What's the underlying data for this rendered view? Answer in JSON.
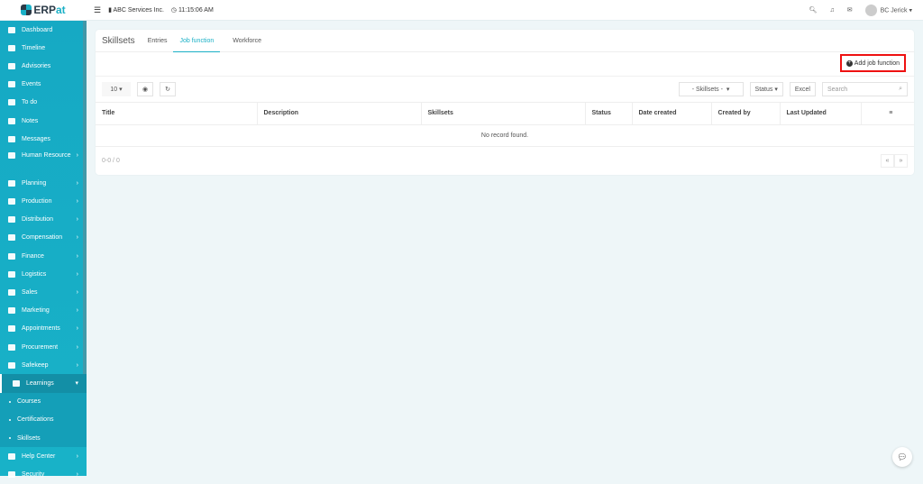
{
  "header": {
    "brand": "ERPat",
    "company": "ABC Services Inc.",
    "time": "11:15:06 AM",
    "user": "BC Jerick"
  },
  "sidebar": {
    "items": [
      "Dashboard",
      "Timeline",
      "Advisories",
      "Events",
      "To do",
      "Notes",
      "Messages",
      "Human Resource",
      "Planning",
      "Production",
      "Distribution",
      "Compensation",
      "Finance",
      "Logistics",
      "Sales",
      "Marketing",
      "Appointments",
      "Procurement",
      "Safekeep",
      "Learnings"
    ],
    "expandable": [
      false,
      false,
      false,
      false,
      false,
      false,
      false,
      true,
      true,
      true,
      true,
      true,
      true,
      true,
      true,
      true,
      true,
      true,
      true,
      true
    ],
    "sub": [
      "Courses",
      "Certifications",
      "Skillsets"
    ],
    "after": [
      "Help Center",
      "Security"
    ]
  },
  "page": {
    "title": "Skillsets",
    "tabs": [
      "Entries",
      "Job function",
      "Workforce"
    ],
    "add_label": "Add job function",
    "page_size": "10",
    "skillsets_filter": "- Skillsets -",
    "status_filter": "Status",
    "excel": "Excel",
    "search_placeholder": "Search",
    "columns": [
      "Title",
      "Description",
      "Skillsets",
      "Status",
      "Date created",
      "Created by",
      "Last Updated"
    ],
    "empty": "No record found.",
    "range": "0-0 / 0"
  }
}
